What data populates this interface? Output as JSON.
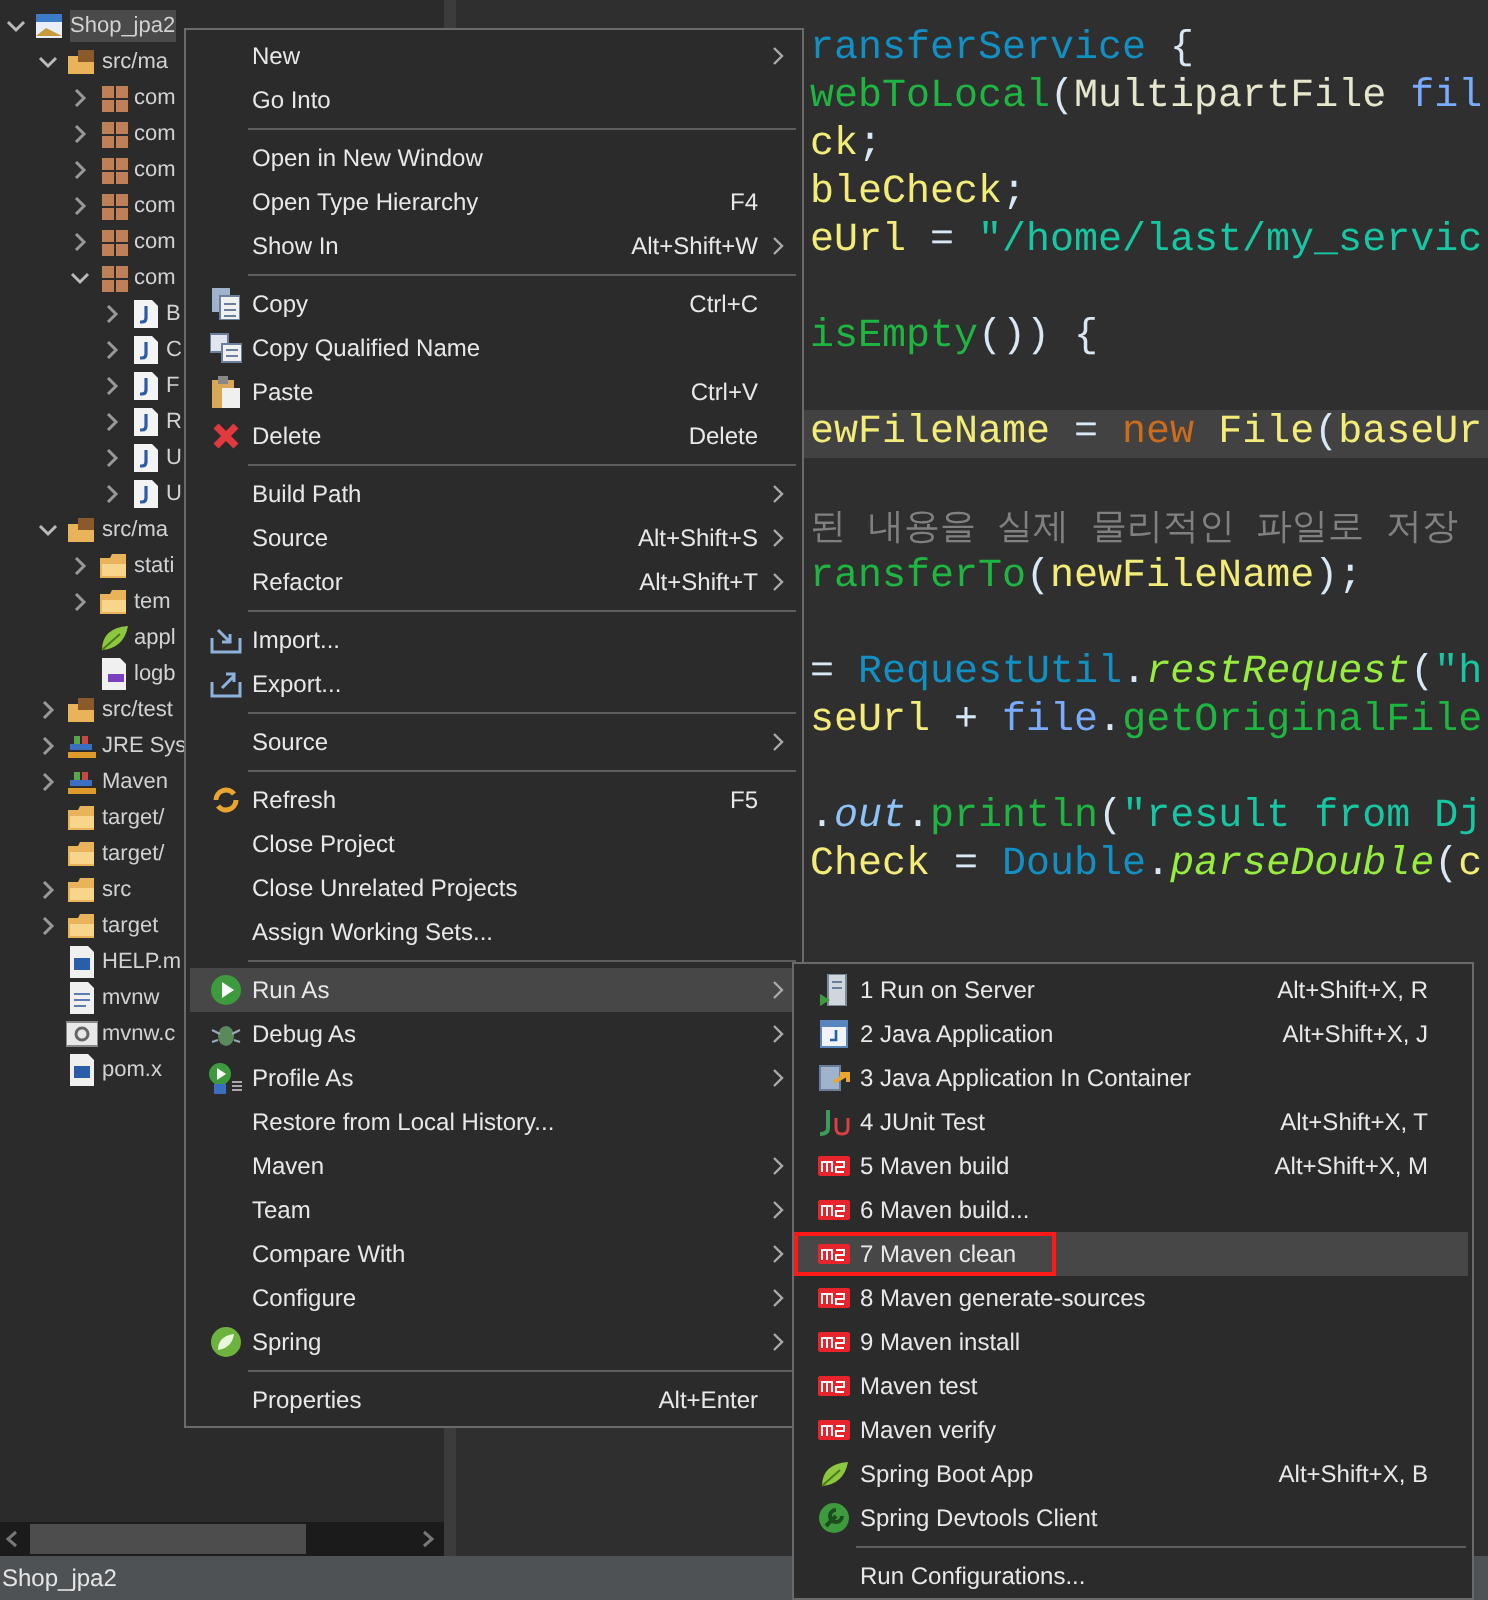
{
  "project_tree": [
    {
      "label": "Shop_jpa2",
      "kind": "node",
      "expanded": true,
      "selected": true,
      "children": [
        {
          "label": "src/ma",
          "kind": "node",
          "expanded": true,
          "selected": false,
          "children": [
            {
              "label": "com",
              "kind": "node",
              "expanded": false,
              "selected": false
            },
            {
              "label": "com",
              "kind": "node",
              "expanded": false,
              "selected": false
            },
            {
              "label": "com",
              "kind": "node",
              "expanded": false,
              "selected": false
            },
            {
              "label": "com",
              "kind": "node",
              "expanded": false,
              "selected": false
            },
            {
              "label": "com",
              "kind": "node",
              "expanded": false,
              "selected": false
            },
            {
              "label": "com",
              "kind": "node",
              "expanded": true,
              "selected": false,
              "children": [
                {
                  "label": "B",
                  "kind": "node",
                  "expanded": false,
                  "selected": false
                },
                {
                  "label": "C",
                  "kind": "node",
                  "expanded": false,
                  "selected": false
                },
                {
                  "label": "F",
                  "kind": "node",
                  "expanded": false,
                  "selected": false
                },
                {
                  "label": "R",
                  "kind": "node",
                  "expanded": false,
                  "selected": false
                },
                {
                  "label": "U",
                  "kind": "node",
                  "expanded": false,
                  "selected": false
                },
                {
                  "label": "U",
                  "kind": "node",
                  "expanded": false,
                  "selected": false
                }
              ]
            }
          ]
        },
        {
          "label": "src/ma",
          "kind": "node",
          "expanded": true,
          "selected": false,
          "children": [
            {
              "label": "stati",
              "kind": "node",
              "expanded": false,
              "selected": false
            },
            {
              "label": "tem",
              "kind": "node",
              "expanded": false,
              "selected": false
            },
            {
              "label": "appl",
              "kind": "leaf",
              "selected": false
            },
            {
              "label": "logb",
              "kind": "leaf",
              "selected": false
            }
          ]
        },
        {
          "label": "src/test",
          "kind": "node",
          "expanded": false,
          "selected": false
        },
        {
          "label": "JRE Sys",
          "kind": "node",
          "expanded": false,
          "selected": false
        },
        {
          "label": "Maven",
          "kind": "node",
          "expanded": false,
          "selected": false
        },
        {
          "label": "target/",
          "kind": "leaf",
          "selected": false
        },
        {
          "label": "target/",
          "kind": "leaf",
          "selected": false
        },
        {
          "label": "src",
          "kind": "node",
          "expanded": false,
          "selected": false
        },
        {
          "label": "target",
          "kind": "node",
          "expanded": false,
          "selected": false
        },
        {
          "label": "HELP.m",
          "kind": "leaf",
          "selected": false
        },
        {
          "label": "mvnw",
          "kind": "leaf",
          "selected": false
        },
        {
          "label": "mvnw.c",
          "kind": "leaf",
          "selected": false
        },
        {
          "label": "pom.x",
          "kind": "leaf",
          "selected": false
        }
      ]
    }
  ],
  "code_lines": [
    {
      "blank_before": false,
      "current": false,
      "segments": [
        {
          "text": "ransferService",
          "kind": "type"
        },
        {
          "text": " {",
          "kind": "plain"
        }
      ]
    },
    {
      "blank_before": false,
      "current": false,
      "segments": [
        {
          "text": "webToLocal",
          "kind": "method"
        },
        {
          "text": "(",
          "kind": "plain"
        },
        {
          "text": "MultipartFile",
          "kind": "class"
        },
        {
          "text": " fil",
          "kind": "param"
        }
      ]
    },
    {
      "blank_before": false,
      "current": false,
      "segments": [
        {
          "text": "ck",
          "kind": "var"
        },
        {
          "text": ";",
          "kind": "plain"
        }
      ]
    },
    {
      "blank_before": false,
      "current": false,
      "segments": [
        {
          "text": "bleCheck",
          "kind": "var"
        },
        {
          "text": ";",
          "kind": "plain"
        }
      ]
    },
    {
      "blank_before": false,
      "current": false,
      "segments": [
        {
          "text": "eUrl",
          "kind": "var"
        },
        {
          "text": " = ",
          "kind": "plain"
        },
        {
          "text": "\"/home/last/my_servic",
          "kind": "string"
        }
      ]
    },
    {
      "blank_before": true,
      "current": false,
      "segments": [
        {
          "text": "isEmpty",
          "kind": "method"
        },
        {
          "text": "()) {",
          "kind": "plain"
        }
      ]
    },
    {
      "blank_before": true,
      "current": true,
      "segments": [
        {
          "text": "ewFileName",
          "kind": "var"
        },
        {
          "text": " = ",
          "kind": "plain"
        },
        {
          "text": "new",
          "kind": "keyword"
        },
        {
          "text": " File",
          "kind": "var"
        },
        {
          "text": "(",
          "kind": "plain"
        },
        {
          "text": "baseUr",
          "kind": "var"
        }
      ]
    },
    {
      "blank_before": true,
      "current": false,
      "segments": [
        {
          "text": "된 내용을 실제 물리적인 파일로 저장",
          "kind": "comment"
        }
      ]
    },
    {
      "blank_before": false,
      "current": false,
      "segments": [
        {
          "text": "ransferTo",
          "kind": "method"
        },
        {
          "text": "(",
          "kind": "plain"
        },
        {
          "text": "newFileName",
          "kind": "var"
        },
        {
          "text": ");",
          "kind": "plain"
        }
      ]
    },
    {
      "blank_before": true,
      "current": false,
      "segments": [
        {
          "text": "= ",
          "kind": "plain"
        },
        {
          "text": "RequestUtil",
          "kind": "type"
        },
        {
          "text": ".",
          "kind": "plain"
        },
        {
          "text": "restRequest",
          "kind": "static_method"
        },
        {
          "text": "(",
          "kind": "plain"
        },
        {
          "text": "\"h",
          "kind": "string"
        }
      ]
    },
    {
      "blank_before": false,
      "current": false,
      "segments": [
        {
          "text": "seUrl",
          "kind": "var"
        },
        {
          "text": " + ",
          "kind": "plain"
        },
        {
          "text": "file",
          "kind": "param"
        },
        {
          "text": ".",
          "kind": "plain"
        },
        {
          "text": "getOriginalFile",
          "kind": "method"
        }
      ]
    },
    {
      "blank_before": true,
      "current": false,
      "segments": [
        {
          "text": ".",
          "kind": "plain"
        },
        {
          "text": "out",
          "kind": "static_field"
        },
        {
          "text": ".",
          "kind": "plain"
        },
        {
          "text": "println",
          "kind": "method"
        },
        {
          "text": "(",
          "kind": "plain"
        },
        {
          "text": "\"result from Dj",
          "kind": "string"
        }
      ]
    },
    {
      "blank_before": false,
      "current": false,
      "segments": [
        {
          "text": "Check",
          "kind": "var"
        },
        {
          "text": " = ",
          "kind": "plain"
        },
        {
          "text": "Double",
          "kind": "type"
        },
        {
          "text": ".",
          "kind": "plain"
        },
        {
          "text": "parseDouble",
          "kind": "static_method"
        },
        {
          "text": "(",
          "kind": "plain"
        },
        {
          "text": "c",
          "kind": "var"
        }
      ]
    }
  ],
  "context_menu": [
    {
      "kind": "item",
      "label": "New",
      "has_submenu": true,
      "selected": false
    },
    {
      "kind": "item",
      "label": "Go Into",
      "has_submenu": false,
      "selected": false
    },
    {
      "kind": "separator"
    },
    {
      "kind": "item",
      "label": "Open in New Window",
      "has_submenu": false,
      "selected": false
    },
    {
      "kind": "item",
      "label": "Open Type Hierarchy",
      "shortcut": "F4",
      "has_submenu": false,
      "selected": false
    },
    {
      "kind": "item",
      "label": "Show In",
      "shortcut": "Alt+Shift+W",
      "has_submenu": true,
      "selected": false
    },
    {
      "kind": "separator"
    },
    {
      "kind": "item",
      "label": "Copy",
      "shortcut": "Ctrl+C",
      "has_submenu": false,
      "selected": false
    },
    {
      "kind": "item",
      "label": "Copy Qualified Name",
      "has_submenu": false,
      "selected": false
    },
    {
      "kind": "item",
      "label": "Paste",
      "shortcut": "Ctrl+V",
      "has_submenu": false,
      "selected": false
    },
    {
      "kind": "item",
      "label": "Delete",
      "shortcut": "Delete",
      "has_submenu": false,
      "selected": false
    },
    {
      "kind": "separator"
    },
    {
      "kind": "item",
      "label": "Build Path",
      "has_submenu": true,
      "selected": false
    },
    {
      "kind": "item",
      "label": "Source",
      "shortcut": "Alt+Shift+S",
      "has_submenu": true,
      "selected": false
    },
    {
      "kind": "item",
      "label": "Refactor",
      "shortcut": "Alt+Shift+T",
      "has_submenu": true,
      "selected": false
    },
    {
      "kind": "separator"
    },
    {
      "kind": "item",
      "label": "Import...",
      "has_submenu": false,
      "selected": false
    },
    {
      "kind": "item",
      "label": "Export...",
      "has_submenu": false,
      "selected": false
    },
    {
      "kind": "separator"
    },
    {
      "kind": "item",
      "label": "Source",
      "has_submenu": true,
      "selected": false
    },
    {
      "kind": "separator"
    },
    {
      "kind": "item",
      "label": "Refresh",
      "shortcut": "F5",
      "has_submenu": false,
      "selected": false
    },
    {
      "kind": "item",
      "label": "Close Project",
      "has_submenu": false,
      "selected": false
    },
    {
      "kind": "item",
      "label": "Close Unrelated Projects",
      "has_submenu": false,
      "selected": false
    },
    {
      "kind": "item",
      "label": "Assign Working Sets...",
      "has_submenu": false,
      "selected": false
    },
    {
      "kind": "separator"
    },
    {
      "kind": "item",
      "label": "Run As",
      "has_submenu": true,
      "selected": true
    },
    {
      "kind": "item",
      "label": "Debug As",
      "has_submenu": true,
      "selected": false
    },
    {
      "kind": "item",
      "label": "Profile As",
      "has_submenu": true,
      "selected": false
    },
    {
      "kind": "item",
      "label": "Restore from Local History...",
      "has_submenu": false,
      "selected": false
    },
    {
      "kind": "item",
      "label": "Maven",
      "has_submenu": true,
      "selected": false
    },
    {
      "kind": "item",
      "label": "Team",
      "has_submenu": true,
      "selected": false
    },
    {
      "kind": "item",
      "label": "Compare With",
      "has_submenu": true,
      "selected": false
    },
    {
      "kind": "item",
      "label": "Configure",
      "has_submenu": true,
      "selected": false
    },
    {
      "kind": "item",
      "label": "Spring",
      "has_submenu": true,
      "selected": false
    },
    {
      "kind": "separator"
    },
    {
      "kind": "item",
      "label": "Properties",
      "shortcut": "Alt+Enter",
      "has_submenu": false,
      "selected": false
    }
  ],
  "run_as_submenu": [
    {
      "kind": "item",
      "label": "1 Run on Server",
      "shortcut": "Alt+Shift+X, R",
      "selected": false,
      "annotated": false
    },
    {
      "kind": "item",
      "label": "2 Java Application",
      "shortcut": "Alt+Shift+X, J",
      "selected": false,
      "annotated": false
    },
    {
      "kind": "item",
      "label": "3 Java Application In Container",
      "selected": false,
      "annotated": false
    },
    {
      "kind": "item",
      "label": "4 JUnit Test",
      "shortcut": "Alt+Shift+X, T",
      "selected": false,
      "annotated": false
    },
    {
      "kind": "item",
      "label": "5 Maven build",
      "shortcut": "Alt+Shift+X, M",
      "selected": false,
      "annotated": false
    },
    {
      "kind": "item",
      "label": "6 Maven build...",
      "selected": false,
      "annotated": false
    },
    {
      "kind": "item",
      "label": "7 Maven clean",
      "selected": true,
      "annotated": true
    },
    {
      "kind": "item",
      "label": "8 Maven generate-sources",
      "selected": false,
      "annotated": false
    },
    {
      "kind": "item",
      "label": "9 Maven install",
      "selected": false,
      "annotated": false
    },
    {
      "kind": "item",
      "label": "Maven test",
      "selected": false,
      "annotated": false
    },
    {
      "kind": "item",
      "label": "Maven verify",
      "selected": false,
      "annotated": false
    },
    {
      "kind": "item",
      "label": "Spring Boot App",
      "shortcut": "Alt+Shift+X, B",
      "selected": false,
      "annotated": false
    },
    {
      "kind": "item",
      "label": "Spring Devtools Client",
      "selected": false,
      "annotated": false
    },
    {
      "kind": "separator"
    },
    {
      "kind": "item",
      "label": "Run Configurations...",
      "selected": false,
      "annotated": false
    }
  ],
  "status_bar": {
    "text": "Shop_jpa2"
  }
}
